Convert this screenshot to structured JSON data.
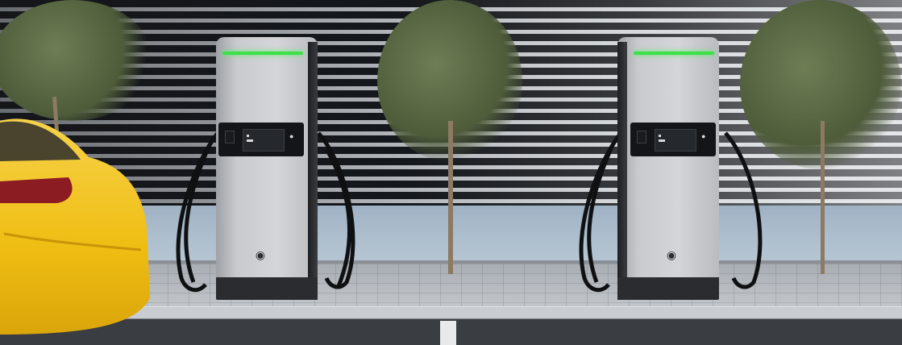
{
  "scene": {
    "description_free": true,
    "colors": {
      "led": "#3ee04a",
      "charger_body": "#d3d5d8",
      "charger_base": "#2a2c30",
      "car": "#f2c21c",
      "road": "#3a3d42"
    },
    "icons": [
      "charger-logo-icon",
      "nfc-icon"
    ]
  }
}
